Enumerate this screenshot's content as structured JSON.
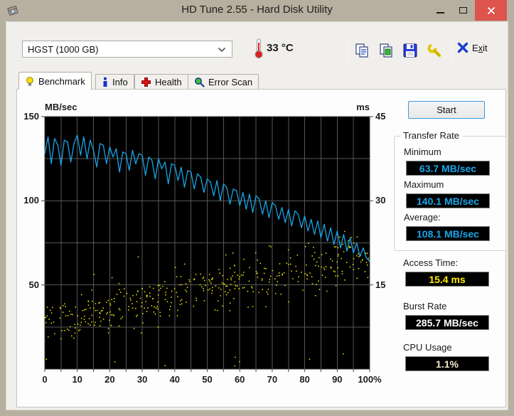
{
  "window": {
    "title": "HD Tune 2.55 - Hard Disk Utility"
  },
  "toolbar": {
    "drive_selected": "HGST (1000 GB)",
    "temperature": "33 °C",
    "icons": [
      "copy-text-icon",
      "copy-image-icon",
      "save-icon",
      "options-icon"
    ],
    "exit": {
      "pre": "E",
      "x": "x",
      "post": "it"
    }
  },
  "tabs": [
    {
      "label": "Benchmark",
      "icon": "lightbulb-icon",
      "active": true
    },
    {
      "label": "Info",
      "icon": "info-icon",
      "active": false
    },
    {
      "label": "Health",
      "icon": "health-cross-icon",
      "active": false
    },
    {
      "label": "Error Scan",
      "icon": "magnifier-icon",
      "active": false
    }
  ],
  "benchmark": {
    "start_label": "Start",
    "transfer_rate": {
      "group_label": "Transfer Rate",
      "minimum_label": "Minimum",
      "minimum_value": "63.7 MB/sec",
      "maximum_label": "Maximum",
      "maximum_value": "140.1 MB/sec",
      "average_label": "Average:",
      "average_value": "108.1 MB/sec"
    },
    "access_time_label": "Access Time:",
    "access_time_value": "15.4 ms",
    "burst_rate_label": "Burst Rate",
    "burst_rate_value": "285.7 MB/sec",
    "cpu_usage_label": "CPU Usage",
    "cpu_usage_value": "1.1%"
  },
  "chart_data": {
    "type": "line_scatter",
    "background": "#000000",
    "grid_color": "#565656",
    "grid": {
      "x_interval_pct": 5,
      "y_interval_mbs": 25
    },
    "x_axis": {
      "min": 0,
      "max": 100,
      "tick_pcts": [
        0,
        10,
        20,
        30,
        40,
        50,
        60,
        70,
        80,
        90,
        100
      ],
      "tick_labels": [
        "0",
        "10",
        "20",
        "30",
        "40",
        "50",
        "60",
        "70",
        "80",
        "90",
        "100%"
      ],
      "minor_tick_pct": 5
    },
    "left_axis": {
      "label": "MB/sec",
      "min": 0,
      "max": 150,
      "tick_values": [
        150,
        100,
        50
      ]
    },
    "right_axis": {
      "label": "ms",
      "min": 0,
      "max": 45,
      "tick_values": [
        45,
        30,
        15
      ]
    },
    "series": [
      {
        "name": "transfer_rate",
        "type": "line",
        "unit": "MB/sec",
        "color": "#18a5e6",
        "x_start": 0,
        "x_step": 1,
        "values": [
          128,
          138,
          122,
          137,
          133,
          121,
          136,
          135,
          123,
          134,
          139,
          127,
          138,
          125,
          136,
          130,
          120,
          134,
          133,
          122,
          132,
          126,
          131,
          117,
          129,
          128,
          118,
          130,
          122,
          128,
          127,
          115,
          126,
          124,
          113,
          125,
          119,
          123,
          110,
          122,
          121,
          112,
          120,
          108,
          118,
          117,
          107,
          116,
          114,
          105,
          113,
          111,
          103,
          112,
          100,
          110,
          108,
          98,
          107,
          106,
          97,
          105,
          95,
          104,
          93,
          103,
          101,
          92,
          100,
          90,
          99,
          97,
          89,
          96,
          87,
          95,
          85,
          94,
          92,
          84,
          91,
          82,
          89,
          80,
          88,
          78,
          86,
          76,
          84,
          74,
          82,
          72,
          80,
          70,
          78,
          69,
          75,
          67,
          72,
          66,
          64
        ]
      },
      {
        "name": "access_time",
        "type": "scatter",
        "unit": "ms",
        "color": "#f2f200",
        "average_ms": 15.4,
        "model": {
          "count": 430,
          "seed": 11,
          "center_start_ms": 8.5,
          "center_end_ms": 20,
          "spread_ms": 4.2,
          "outlier_prob": 0.05,
          "outlier_extra_ms": 7,
          "low_cluster_below_x_pct": 10,
          "low_cluster_prob": 0.45,
          "min_ms": 0.4,
          "max_ms": 29
        }
      }
    ]
  }
}
